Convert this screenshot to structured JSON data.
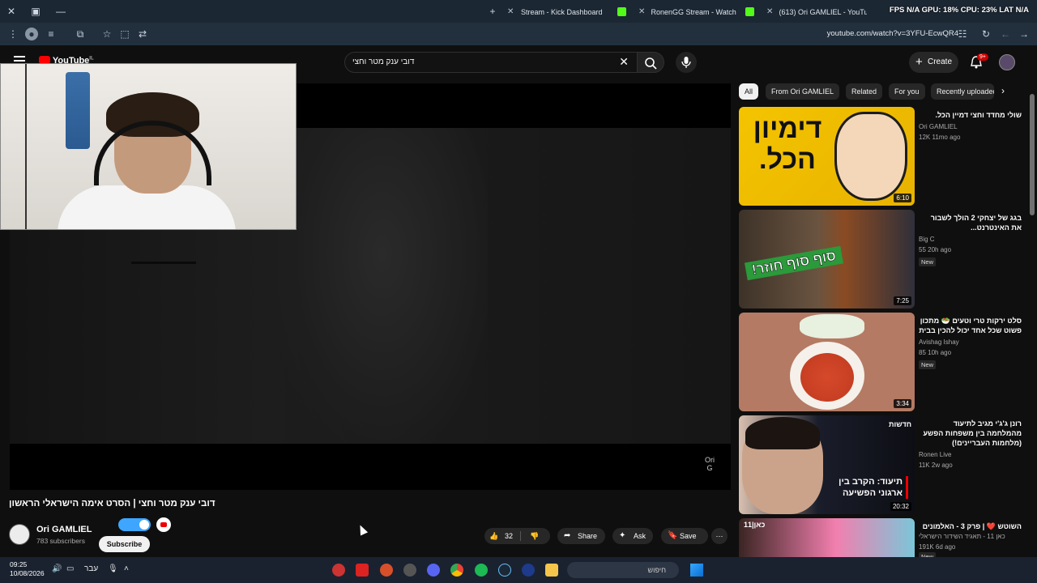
{
  "browser": {
    "tabs": [
      {
        "title": "Stream - Kick Dashboard",
        "icon": "kick-icon"
      },
      {
        "title": "RonenGG Stream - Watch Live",
        "icon": "kick-icon"
      },
      {
        "title": "(613) Ori GAMLIEL - YouTube",
        "icon": "kick-icon"
      }
    ],
    "hud_text": "FPS N/A  GPU: 18%  CPU: 23%  LAT N/A",
    "url": "youtube.com/watch?v=3YFU-EcwQR4"
  },
  "youtube": {
    "logo_text": "YouTube",
    "logo_superscript": "IL",
    "search_query": "דובי ענק מטר וחצי",
    "create_label": "Create",
    "notification_count": "9+",
    "video_title": "דובי ענק מטר וחצי | הסרט אימה הישראלי הראשון",
    "channel_name": "Ori GAMLIEL",
    "subscribers": "783 subscribers",
    "subscribe_label": "Subscribe",
    "likes": "32",
    "share_label": "Share",
    "ask_label": "Ask",
    "save_label": "Save",
    "watermark": "Ori\nG",
    "chips": [
      "All",
      "From Ori GAMLIEL",
      "Related",
      "For you",
      "Recently uploaded"
    ],
    "recommendations": [
      {
        "title": "שולי מחדד וחצי דמיין הכל.",
        "channel": "Ori GAMLIEL",
        "meta": "12K  11mo ago",
        "duration": "6:10",
        "thumb_text": "דימיון הכל.",
        "badge": ""
      },
      {
        "title": "בגג של יצחקי 2 הולך לשבור את האינטרנט...",
        "channel": "Big C",
        "meta": "55  20h ago",
        "duration": "7:25",
        "thumb_text": "סוף סוף חוזר!",
        "badge": "New"
      },
      {
        "title": "סלט ירקות טרי וטעים 🥗 מתכון פשוט שכל אחד יכול להכין בבית",
        "channel": "Avishag Ishay",
        "meta": "85  10h ago",
        "duration": "3:34",
        "thumb_text": "",
        "badge": "New"
      },
      {
        "title": "רונן ג'ג'י מגיב לתיעוד מהמלחמה בין משפחות הפשע (מלחמות העבריינים!)",
        "channel": "Ronen Live",
        "meta": "11K  2w ago",
        "duration": "20:32",
        "thumb_text": "תיעוד: הקרב בין ארגוני הפשיעה",
        "thumb_tag": "חדשות",
        "badge": ""
      },
      {
        "title": "השוטש ❤️ | פרק 3 - האלמונים",
        "channel": "כאן 11 - תאגיד השידור הישראלי",
        "meta": "191K  6d ago",
        "duration": "",
        "thumb_tag": "כאן|11",
        "badge": "New"
      }
    ]
  },
  "taskbar": {
    "time": "09:25",
    "date": "10/08/2026",
    "lang": "עבר",
    "search_placeholder": "חיפוש"
  },
  "colors": {
    "accent_blue": "#3ea6ff",
    "youtube_red": "#ff0000",
    "kick_green": "#53fc18"
  }
}
